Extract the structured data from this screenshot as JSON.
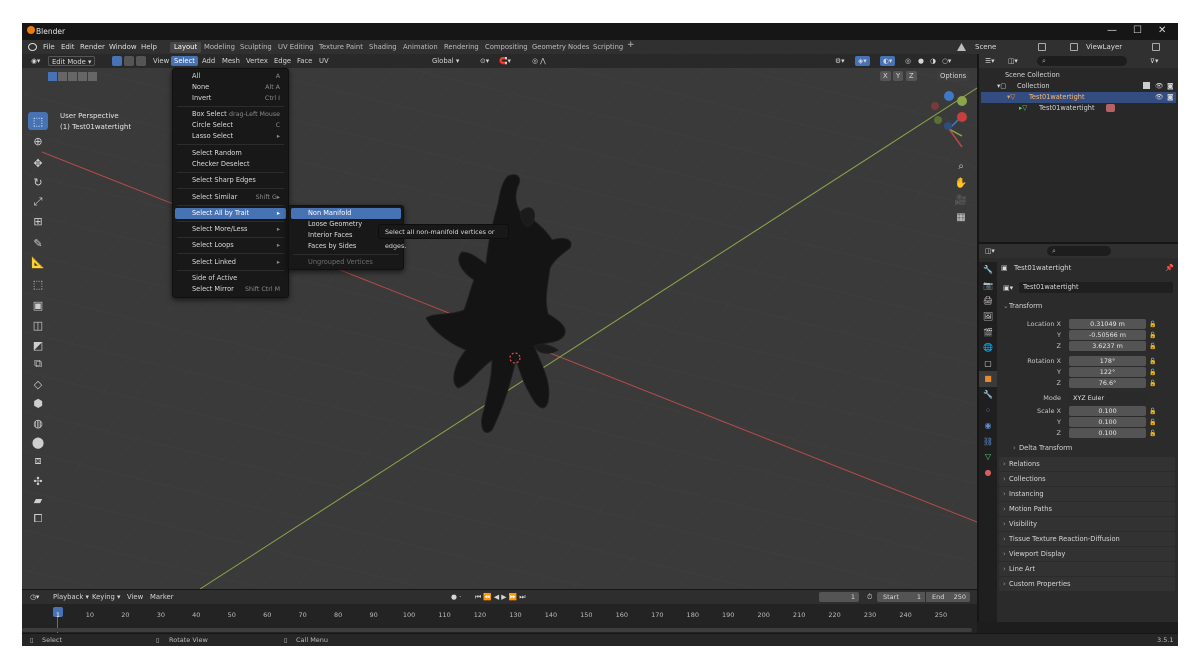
{
  "window": {
    "title": "Blender",
    "controls": [
      "—",
      "☐",
      "✕"
    ]
  },
  "menubar": {
    "menus": [
      "File",
      "Edit",
      "Render",
      "Window",
      "Help"
    ],
    "workspaces": [
      "Layout",
      "Modeling",
      "Sculpting",
      "UV Editing",
      "Texture Paint",
      "Shading",
      "Animation",
      "Rendering",
      "Compositing",
      "Geometry Nodes",
      "Scripting"
    ],
    "active_workspace": "Layout",
    "add_workspace": "+",
    "scene": "Scene",
    "view_layer": "ViewLayer"
  },
  "viewport_header": {
    "mode": "Edit Mode",
    "menus": [
      "View",
      "Select",
      "Add",
      "Mesh",
      "Vertex",
      "Edge",
      "Face",
      "UV"
    ],
    "active_menu": "Select",
    "transform_orientation": "Global",
    "options_label": "Options",
    "axis_toggles": [
      "X",
      "Y",
      "Z"
    ]
  },
  "viewport_overlay": {
    "perspective": "User Perspective",
    "object": "(1) Test01watertight"
  },
  "select_menu": {
    "items": [
      {
        "label": "All",
        "shortcut": "A"
      },
      {
        "label": "None",
        "shortcut": "Alt A"
      },
      {
        "label": "Invert",
        "shortcut": "Ctrl I"
      },
      {
        "label": "Box Select",
        "shortcut": "drag-Left Mouse"
      },
      {
        "label": "Circle Select",
        "shortcut": "C"
      },
      {
        "label": "Lasso Select",
        "shortcut": "▸"
      },
      {
        "label": "Select Random",
        "shortcut": ""
      },
      {
        "label": "Checker Deselect",
        "shortcut": ""
      },
      {
        "label": "Select Sharp Edges",
        "shortcut": ""
      },
      {
        "label": "Select Similar",
        "shortcut": "Shift G▸"
      },
      {
        "label": "Select All by Trait",
        "shortcut": "▸"
      },
      {
        "label": "Select More/Less",
        "shortcut": "▸"
      },
      {
        "label": "Select Loops",
        "shortcut": "▸"
      },
      {
        "label": "Select Linked",
        "shortcut": "▸"
      },
      {
        "label": "Side of Active",
        "shortcut": ""
      },
      {
        "label": "Select Mirror",
        "shortcut": "Shift Ctrl M"
      }
    ],
    "highlighted": "Select All by Trait"
  },
  "trait_submenu": {
    "items": [
      "Non Manifold",
      "Loose Geometry",
      "Interior Faces",
      "Faces by Sides",
      "Ungrouped Vertices"
    ],
    "highlighted": "Non Manifold",
    "disabled": "Ungrouped Vertices"
  },
  "tooltip": "Select all non-manifold vertices or edges.",
  "outliner": {
    "rows": [
      {
        "label": "Scene Collection"
      },
      {
        "label": "Collection"
      },
      {
        "label": "Test01watertight"
      },
      {
        "label": "Test01watertight"
      }
    ]
  },
  "properties": {
    "object_name": "Test01watertight",
    "data_name": "Test01watertight",
    "transform_label": "Transform",
    "location_label": "Location X",
    "rotation_label": "Rotation X",
    "scale_label": "Scale X",
    "y_label": "Y",
    "z_label": "Z",
    "mode_label": "Mode",
    "location": [
      "0.31049 m",
      "-0.50566 m",
      "3.6237 m"
    ],
    "rotation": [
      "178°",
      "122°",
      "76.6°"
    ],
    "mode": "XYZ Euler",
    "scale": [
      "0.100",
      "0.100",
      "0.100"
    ],
    "sections": [
      "Delta Transform",
      "Relations",
      "Collections",
      "Instancing",
      "Motion Paths",
      "Visibility",
      "Tissue Texture Reaction-Diffusion",
      "Viewport Display",
      "Line Art",
      "Custom Properties"
    ]
  },
  "timeline": {
    "menus": [
      "Playback",
      "Keying",
      "View",
      "Marker"
    ],
    "current_frame": "1",
    "start_label": "Start",
    "start": "1",
    "end_label": "End",
    "end": "250",
    "ticks": [
      "1",
      "10",
      "20",
      "30",
      "40",
      "50",
      "60",
      "70",
      "80",
      "90",
      "100",
      "110",
      "120",
      "130",
      "140",
      "150",
      "160",
      "170",
      "180",
      "190",
      "200",
      "210",
      "220",
      "230",
      "240",
      "250"
    ]
  },
  "statusbar": {
    "items": [
      "Select",
      "Rotate View",
      "Call Menu"
    ],
    "version": "3.5.1"
  },
  "colors": {
    "accent": "#4772b3",
    "x_axis": "#b34a4a",
    "y_axis": "#8aa64a",
    "z_axis": "#3f78c8",
    "mesh": "#111111"
  },
  "icons": [
    "blender-logo-icon",
    "cursor-icon",
    "move-icon",
    "rotate-icon",
    "scale-icon",
    "transform-icon",
    "annotate-icon",
    "measure-icon",
    "zoom-icon",
    "hand-icon",
    "camera-icon",
    "grid-icon"
  ]
}
